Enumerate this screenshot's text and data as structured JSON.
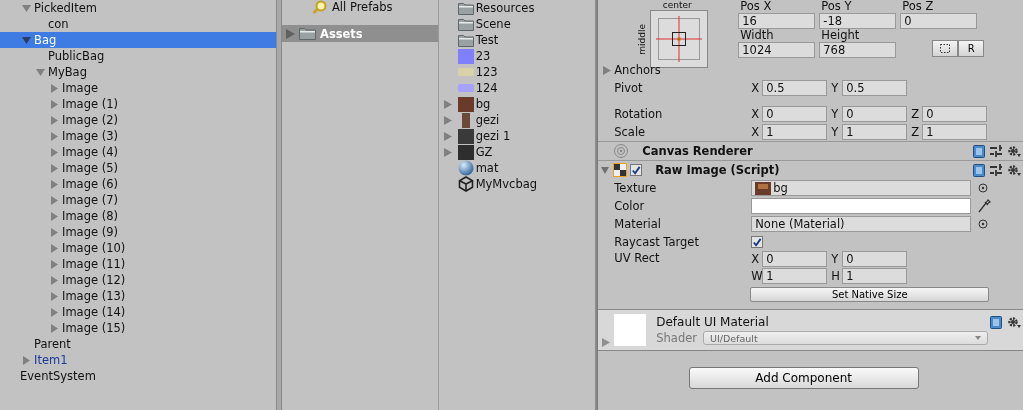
{
  "hierarchy": {
    "items": [
      {
        "label": "PickedItem",
        "kind": "object",
        "expanded": true,
        "selected": false,
        "children": [
          {
            "label": "con",
            "kind": "object",
            "selected": false
          }
        ]
      },
      {
        "label": "Bag",
        "kind": "object",
        "expanded": true,
        "selected": true,
        "children": [
          {
            "label": "PublicBag",
            "kind": "object",
            "selected": false
          },
          {
            "label": "MyBag",
            "kind": "object",
            "expanded": true,
            "selected": false,
            "children": [
              {
                "label": "Image",
                "kind": "object",
                "expanded": false,
                "selected": false
              },
              {
                "label": "Image (1)",
                "kind": "object",
                "expanded": false,
                "selected": false
              },
              {
                "label": "Image (2)",
                "kind": "object",
                "expanded": false,
                "selected": false
              },
              {
                "label": "Image (3)",
                "kind": "object",
                "expanded": false,
                "selected": false
              },
              {
                "label": "Image (4)",
                "kind": "object",
                "expanded": false,
                "selected": false
              },
              {
                "label": "Image (5)",
                "kind": "object",
                "expanded": false,
                "selected": false
              },
              {
                "label": "Image (6)",
                "kind": "object",
                "expanded": false,
                "selected": false
              },
              {
                "label": "Image (7)",
                "kind": "object",
                "expanded": false,
                "selected": false
              },
              {
                "label": "Image (8)",
                "kind": "object",
                "expanded": false,
                "selected": false
              },
              {
                "label": "Image (9)",
                "kind": "object",
                "expanded": false,
                "selected": false
              },
              {
                "label": "Image (10)",
                "kind": "object",
                "expanded": false,
                "selected": false
              },
              {
                "label": "Image (11)",
                "kind": "object",
                "expanded": false,
                "selected": false
              },
              {
                "label": "Image (12)",
                "kind": "object",
                "expanded": false,
                "selected": false
              },
              {
                "label": "Image (13)",
                "kind": "object",
                "expanded": false,
                "selected": false
              },
              {
                "label": "Image (14)",
                "kind": "object",
                "expanded": false,
                "selected": false
              },
              {
                "label": "Image (15)",
                "kind": "object",
                "expanded": false,
                "selected": false
              }
            ]
          }
        ]
      },
      {
        "label": "Parent",
        "kind": "object",
        "selected": false
      },
      {
        "label": "Item1",
        "kind": "prefab",
        "expanded": false,
        "selected": false
      }
    ],
    "root_items": [
      {
        "label": "EventSystem",
        "kind": "object",
        "selected": false
      }
    ]
  },
  "project": {
    "favorites": [
      {
        "label": "All Prefabs"
      }
    ],
    "folders": [
      {
        "label": "Assets",
        "expanded": false,
        "selected": true
      }
    ],
    "assets": [
      {
        "label": "Resources",
        "kind": "folder"
      },
      {
        "label": "Scene",
        "kind": "folder"
      },
      {
        "label": "Test",
        "kind": "folder"
      },
      {
        "label": "23",
        "kind": "texture",
        "color": "#8080ff"
      },
      {
        "label": "123",
        "kind": "sprite",
        "color": "#d8d2a8"
      },
      {
        "label": "124",
        "kind": "sprite",
        "color": "#a8a0ff"
      },
      {
        "label": "bg",
        "kind": "texture",
        "color": "#6a3a2a",
        "expanded": false
      },
      {
        "label": "gezi",
        "kind": "tall-texture",
        "color": "#6b4a3a",
        "expanded": false
      },
      {
        "label": "gezi 1",
        "kind": "texture",
        "color": "#3a3a3a",
        "expanded": false
      },
      {
        "label": "GZ",
        "kind": "texture",
        "color": "#2e2e2e",
        "expanded": false
      },
      {
        "label": "mat",
        "kind": "material"
      },
      {
        "label": "MyMvcbag",
        "kind": "script"
      }
    ]
  },
  "inspector": {
    "rect_transform": {
      "anchor_horizontal": "center",
      "anchor_vertical": "middle",
      "position_fields": [
        {
          "label": "Pos X",
          "value": "16"
        },
        {
          "label": "Pos Y",
          "value": "-18"
        },
        {
          "label": "Pos Z",
          "value": "0"
        }
      ],
      "size_fields": [
        {
          "label": "Width",
          "value": "1024"
        },
        {
          "label": "Height",
          "value": "768"
        }
      ],
      "raw_edit_button": "R",
      "anchors": {
        "label": "Anchors",
        "expanded": false
      },
      "vector_rows": [
        {
          "label": "Pivot",
          "fields": [
            {
              "axis": "X",
              "value": "0.5"
            },
            {
              "axis": "Y",
              "value": "0.5"
            }
          ]
        },
        {
          "label": "Rotation",
          "fields": [
            {
              "axis": "X",
              "value": "0"
            },
            {
              "axis": "Y",
              "value": "0"
            },
            {
              "axis": "Z",
              "value": "0"
            }
          ]
        },
        {
          "label": "Scale",
          "fields": [
            {
              "axis": "X",
              "value": "1"
            },
            {
              "axis": "Y",
              "value": "1"
            },
            {
              "axis": "Z",
              "value": "1"
            }
          ]
        }
      ]
    },
    "components": [
      {
        "title": "Canvas Renderer",
        "kind": "renderer"
      },
      {
        "title": "Raw Image (Script)",
        "kind": "script",
        "expanded": true,
        "enabled": true,
        "properties": [
          {
            "kind": "object",
            "label": "Texture",
            "value": "bg"
          },
          {
            "kind": "color",
            "label": "Color",
            "color": "#ffffff"
          },
          {
            "kind": "object",
            "label": "Material",
            "value": "None (Material)"
          },
          {
            "kind": "checkbox",
            "label": "Raycast Target",
            "checked": true
          },
          {
            "kind": "rect",
            "label": "UV Rect",
            "fields": [
              {
                "axis": "X",
                "value": "0"
              },
              {
                "axis": "Y",
                "value": "0"
              },
              {
                "axis": "W",
                "value": "1"
              },
              {
                "axis": "H",
                "value": "1"
              }
            ]
          },
          {
            "kind": "button",
            "label": "Set Native Size"
          }
        ]
      }
    ],
    "material": {
      "name": "Default UI Material",
      "shader_label": "Shader",
      "shader": "UI/Default",
      "expanded": false
    },
    "add_component": "Add Component"
  }
}
